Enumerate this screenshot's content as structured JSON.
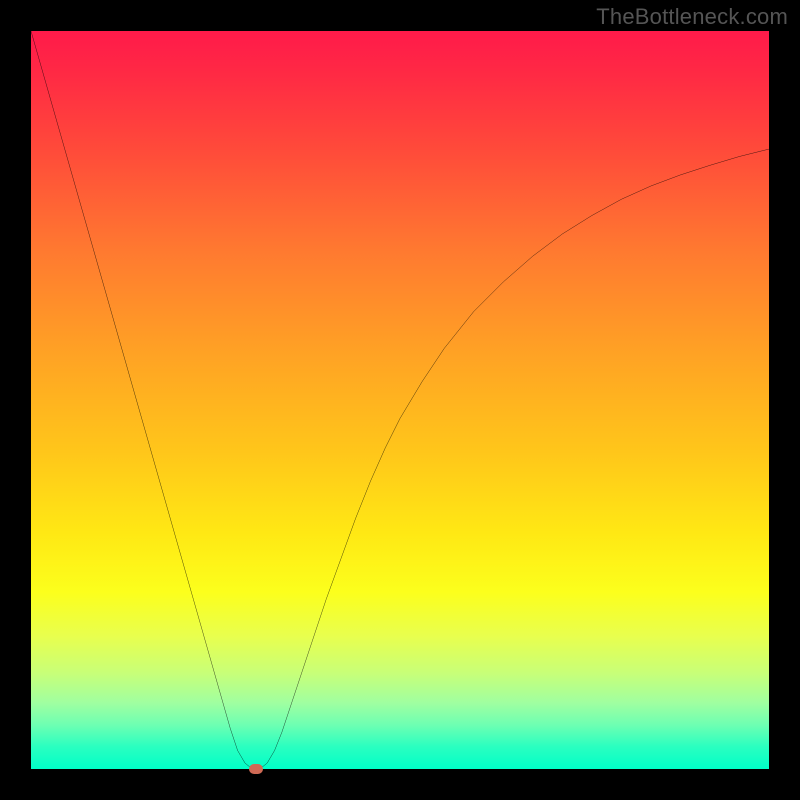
{
  "watermark": "TheBottleneck.com",
  "chart_data": {
    "type": "line",
    "title": "",
    "xlabel": "",
    "ylabel": "",
    "xlim": [
      0,
      100
    ],
    "ylim": [
      0,
      100
    ],
    "x": [
      0,
      2,
      4,
      6,
      8,
      10,
      12,
      14,
      16,
      18,
      20,
      22,
      24,
      26,
      27,
      28,
      29,
      30,
      31,
      32,
      33,
      34,
      36,
      38,
      40,
      42,
      44,
      46,
      48,
      50,
      53,
      56,
      60,
      64,
      68,
      72,
      76,
      80,
      84,
      88,
      92,
      96,
      100
    ],
    "y": [
      100,
      93,
      86,
      79,
      72,
      65,
      58,
      51,
      44,
      37,
      30,
      23,
      16,
      9,
      5.5,
      2.5,
      0.8,
      0,
      0,
      0.8,
      2.5,
      5,
      11,
      17,
      23,
      28.5,
      34,
      39,
      43.5,
      47.5,
      52.5,
      57,
      62,
      66,
      69.5,
      72.5,
      75,
      77.2,
      79,
      80.5,
      81.8,
      83,
      84
    ],
    "marker": {
      "x": 30.5,
      "y": 0
    },
    "colors": {
      "top": "#ff1a4a",
      "bottom": "#00ffc8",
      "curve": "#000000",
      "marker": "#cf6a55",
      "frame": "#000000"
    }
  }
}
